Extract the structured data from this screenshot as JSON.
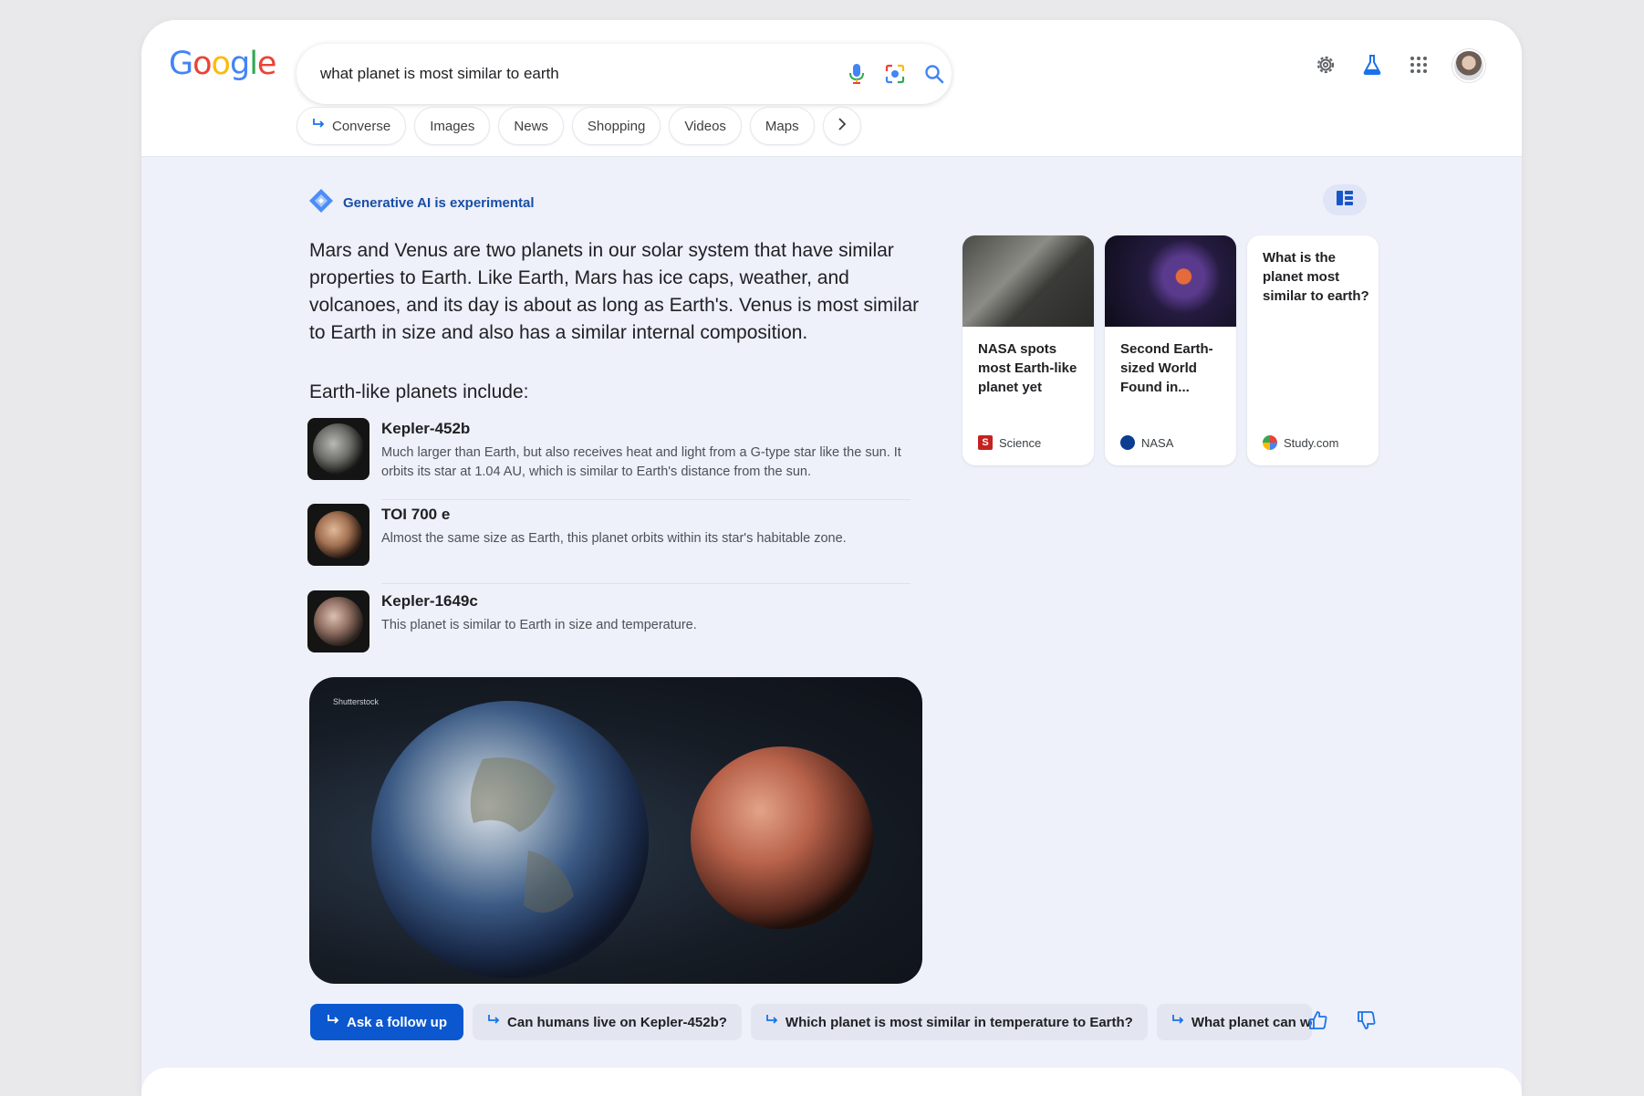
{
  "search": {
    "query": "what planet is most similar to earth",
    "logo": [
      "G",
      "o",
      "o",
      "g",
      "l",
      "e"
    ]
  },
  "colors": {
    "logo": [
      "#4285f4",
      "#ea4335",
      "#fbbc05",
      "#4285f4",
      "#34a853",
      "#ea4335"
    ],
    "accent": "#0b57d0",
    "ai_label": "#174ea6"
  },
  "icons": {
    "mic": "mic-icon",
    "lens": "lens-icon",
    "search": "search-icon",
    "settings": "gear-icon",
    "labs": "flask-icon",
    "apps": "apps-grid-icon",
    "layout": "layout-toggle-icon",
    "converse": "reply-arrow-icon",
    "like": "thumbs-up-icon",
    "dislike": "thumbs-down-icon"
  },
  "tabs": [
    {
      "label": "Converse"
    },
    {
      "label": "Images"
    },
    {
      "label": "News"
    },
    {
      "label": "Shopping"
    },
    {
      "label": "Videos"
    },
    {
      "label": "Maps"
    }
  ],
  "ai": {
    "label": "Generative AI is experimental",
    "summary": "Mars and Venus are two planets in our solar system that have similar properties to Earth. Like Earth, Mars has ice caps, weather, and volcanoes, and its day is about as long as Earth's. Venus is most similar to Earth in size and also has a similar internal composition.",
    "subhead": "Earth-like planets include:",
    "planets": [
      {
        "name": "Kepler-452b",
        "desc": "Much larger than Earth, but also receives heat and light from a G-type star like the sun. It orbits its star at 1.04 AU, which is similar to Earth's distance from the sun."
      },
      {
        "name": "TOI 700 e",
        "desc": "Almost the same size as Earth, this planet orbits within its star's habitable zone."
      },
      {
        "name": "Kepler-1649c",
        "desc": "This planet is similar to Earth in size and temperature."
      }
    ],
    "image_credit": "Shutterstock"
  },
  "sources": [
    {
      "title": "NASA spots most Earth-like planet yet",
      "site": "Science"
    },
    {
      "title": "Second Earth-sized World Found in...",
      "site": "NASA"
    },
    {
      "title": "What is the planet most similar to earth?",
      "site": "Study.com"
    }
  ],
  "followups": {
    "primary": "Ask a follow up",
    "suggestions": [
      "Can humans live on Kepler-452b?",
      "Which planet is most similar in temperature to Earth?",
      "What planet can we"
    ]
  }
}
